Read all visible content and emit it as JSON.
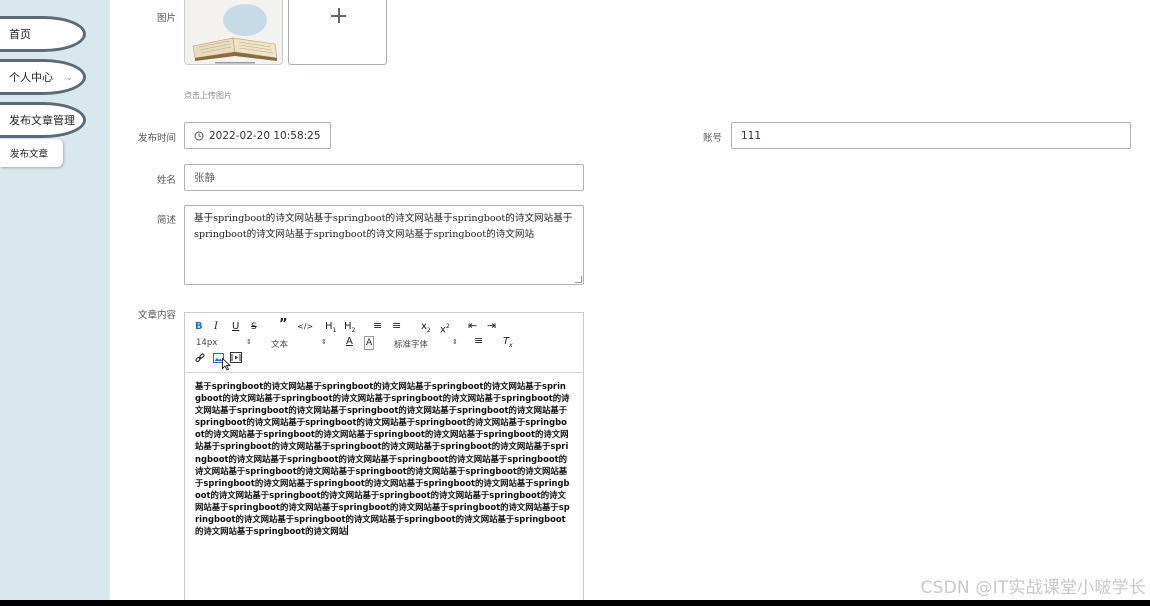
{
  "sidebar": {
    "items": [
      {
        "label": "首页"
      },
      {
        "label": "个人中心"
      },
      {
        "label": "发布文章管理"
      }
    ],
    "sub_item": "发布文章",
    "chevron": "chevron-down-icon"
  },
  "form": {
    "image_label": "图片",
    "upload_hint": "点击上传图片",
    "publish_time_label": "发布时间",
    "publish_time_value": "2022-02-20 10:58:25",
    "account_label": "账号",
    "account_value": "111",
    "name_label": "姓名",
    "name_value": "张静",
    "summary_label": "简述",
    "summary_value": "基于springboot的诗文网站基于springboot的诗文网站基于springboot的诗文网站基于springboot的诗文网站基于springboot的诗文网站基于springboot的诗文网站",
    "content_label": "文章内容"
  },
  "editor": {
    "font_size": "14px",
    "paragraph": "文本",
    "font_family": "标准字体",
    "content": "基于springboot的诗文网站基于springboot的诗文网站基于springboot的诗文网站基于springboot的诗文网站基于springboot的诗文网站基于springboot的诗文网站基于springboot的诗文网站基于springboot的诗文网站基于springboot的诗文网站基于springboot的诗文网站基于springboot的诗文网站基于springboot的诗文网站基于springboot的诗文网站基于springboot的诗文网站基于springboot的诗文网站基于springboot的诗文网站基于springboot的诗文网站基于springboot的诗文网站基于springboot的诗文网站基于springboot的诗文网站基于springboot的诗文网站基于springboot的诗文网站基于springboot的诗文网站基于springboot的诗文网站基于springboot的诗文网站基于springboot的诗文网站基于springboot的诗文网站基于springboot的诗文网站基于springboot的诗文网站基于springboot的诗文网站基于springboot的诗文网站基于springboot的诗文网站基于springboot的诗文网站基于springboot的诗文网站基于springboot的诗文网站基于springboot的诗文网站基于springboot的诗文网站基于springboot的诗文网站基于springboot的诗文网站基于springboot的诗文网站基于springboot的诗文网站基于springboot的诗文网站"
  },
  "watermark": "CSDN @IT实战课堂小啵学长",
  "colors": {
    "sidebar_bg": "#d9e7ee",
    "accent": "#1f6fd1"
  }
}
